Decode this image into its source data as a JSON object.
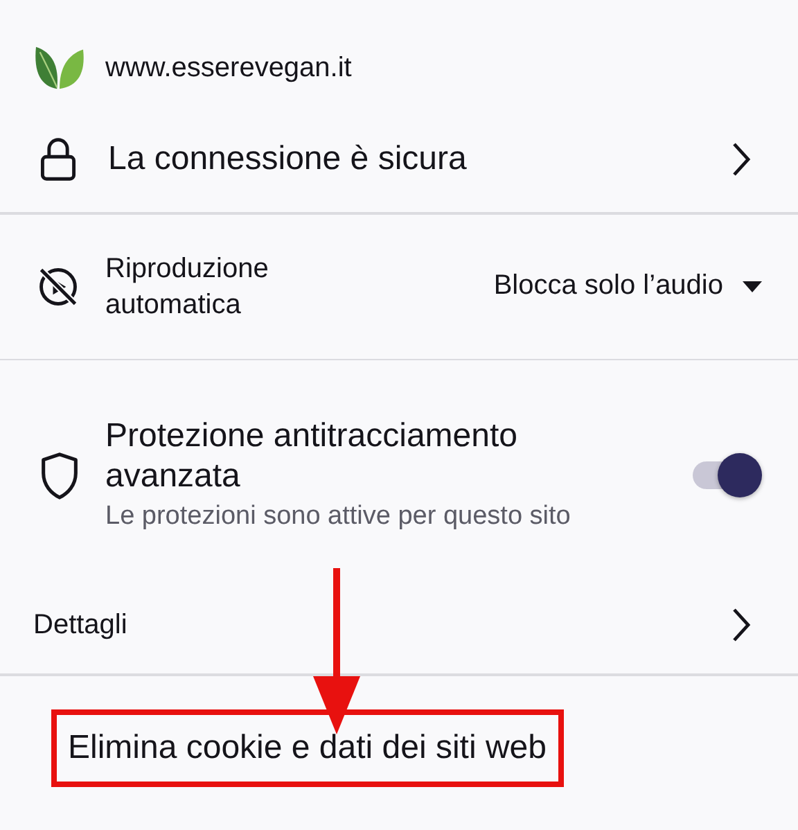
{
  "site": {
    "domain": "www.esserevegan.it"
  },
  "connection": {
    "label": "La connessione è sicura"
  },
  "autoplay": {
    "label": "Riproduzione automatica",
    "value": "Blocca solo l’audio"
  },
  "tracking": {
    "title": "Protezione antitracciamento avanzata",
    "subtitle": "Le protezioni sono attive per questo sito",
    "on": true
  },
  "details": {
    "label": "Dettagli"
  },
  "clear_data": {
    "label": "Elimina cookie e dati dei siti web",
    "highlighted": true
  }
}
